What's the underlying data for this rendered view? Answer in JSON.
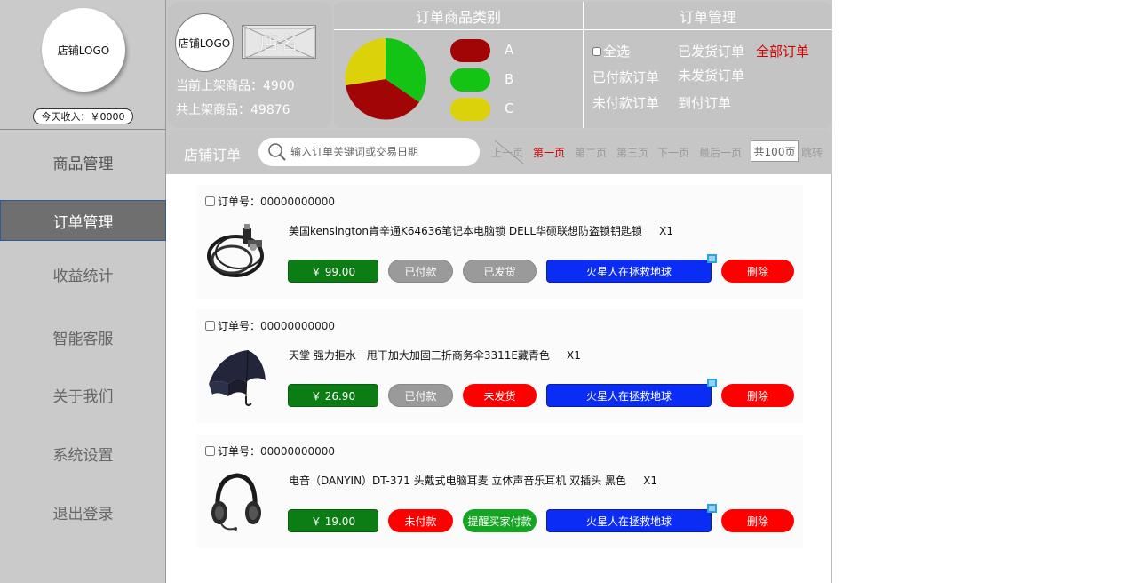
{
  "colors": {
    "panel_bg": "#c4c4c4",
    "active_nav": "#6f6f6f",
    "accent_red": "#d40000",
    "price_green": "#0c7d14",
    "chat_blue": "#0a2cf5",
    "pie_a": "#a10505",
    "pie_b": "#14c414",
    "pie_c": "#dcd20a"
  },
  "sidebar": {
    "logo_text": "店铺LOGO",
    "income": "今天收入：￥0000",
    "items": [
      {
        "label": "商品管理"
      },
      {
        "label": "订单管理"
      },
      {
        "label": "收益统计"
      },
      {
        "label": "智能客服"
      },
      {
        "label": "关于我们"
      },
      {
        "label": "系统设置"
      },
      {
        "label": "退出登录"
      }
    ]
  },
  "store": {
    "logo_text": "店铺LOGO",
    "name": "店名",
    "current_listed": "当前上架商品：4900",
    "total_listed": "共上架商品：49876"
  },
  "category_panel": {
    "title": "订单商品类别",
    "legend": [
      {
        "label": "A",
        "color": "#a10505"
      },
      {
        "label": "B",
        "color": "#14c414"
      },
      {
        "label": "C",
        "color": "#dcd20a"
      }
    ]
  },
  "order_panel": {
    "title": "订单管理",
    "select_all": "全选",
    "links": [
      "已发货订单",
      "全部订单",
      "已付款订单",
      "未发货订单",
      "未付款订单",
      "到付订单"
    ]
  },
  "toolbar": {
    "title": "店铺订单",
    "search_placeholder": "输入订单关键词或交易日期",
    "prev": "上一页",
    "first": "第一页",
    "page2": "第二页",
    "page3": "第三页",
    "next": "下一页",
    "last": "最后一页",
    "total_pages": "共100页",
    "jump": "跳转"
  },
  "orders": [
    {
      "order_label": "订单号：",
      "order_no": "00000000000",
      "title": "美国kensington肯辛通K64636笔记本电脑锁 DELL华硕联想防盗锁钥匙锁",
      "qty": "X1",
      "price": "￥ 99.00",
      "pay_status": "已付款",
      "ship_status": "已发货",
      "chat": "火星人在拯救地球",
      "delete": "删除",
      "image": "cable-lock-icon"
    },
    {
      "order_label": "订单号：",
      "order_no": "00000000000",
      "title": "天堂 强力拒水一甩干加大加固三折商务伞3311E藏青色",
      "qty": "X1",
      "price": "￥ 26.90",
      "pay_status": "已付款",
      "ship_status": "未发货",
      "chat": "火星人在拯救地球",
      "delete": "删除",
      "image": "umbrella-icon"
    },
    {
      "order_label": "订单号：",
      "order_no": "00000000000",
      "title": "电音（DANYIN）DT-371 头戴式电脑耳麦 立体声音乐耳机 双插头 黑色",
      "qty": "X1",
      "price": "￥ 19.00",
      "pay_status": "未付款",
      "ship_status": "提醒买家付款",
      "chat": "火星人在拯救地球",
      "delete": "删除",
      "image": "headphones-icon"
    }
  ]
}
